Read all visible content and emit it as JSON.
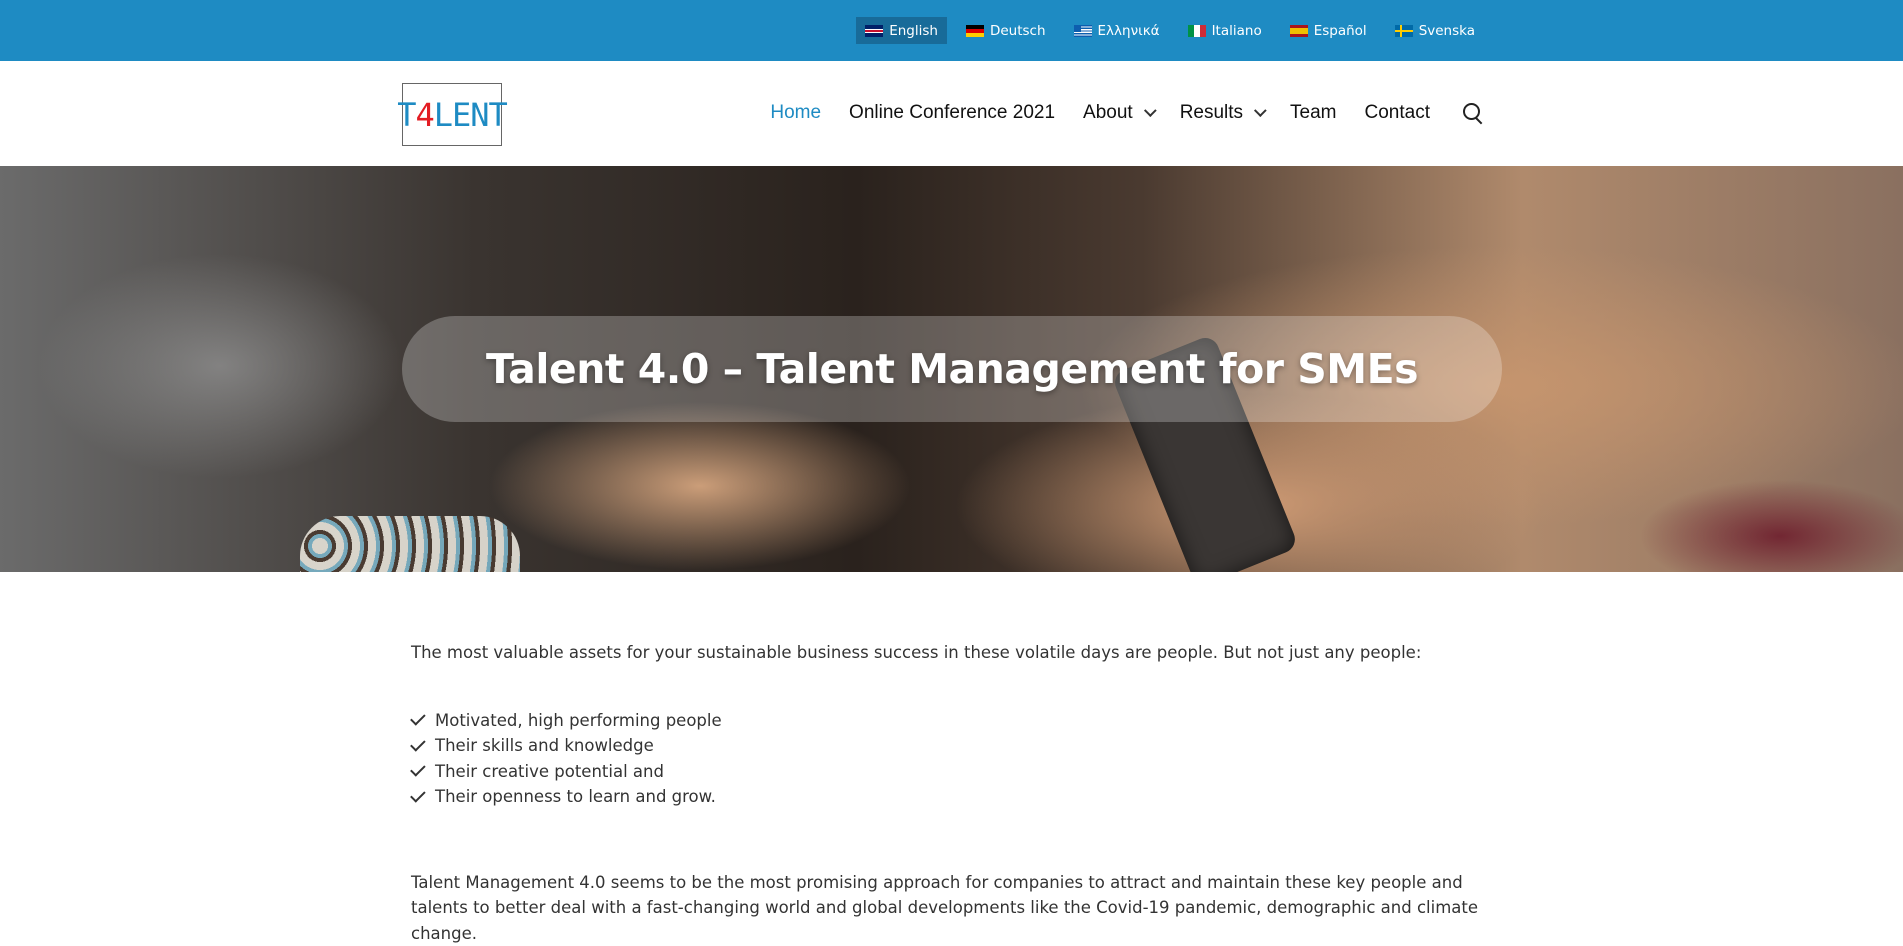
{
  "languages": [
    {
      "label": "English",
      "flag": "uk-flag-icon",
      "active": true
    },
    {
      "label": "Deutsch",
      "flag": "germany-flag-icon"
    },
    {
      "label": "Ελληνικά",
      "flag": "greece-flag-icon"
    },
    {
      "label": "Italiano",
      "flag": "italy-flag-icon"
    },
    {
      "label": "Español",
      "flag": "spain-flag-icon"
    },
    {
      "label": "Svenska",
      "flag": "sweden-flag-icon"
    }
  ],
  "logo": {
    "t": "T",
    "four": "4",
    "rest": "LENT"
  },
  "nav": {
    "home": "Home",
    "conference": "Online Conference 2021",
    "about": "About",
    "results": "Results",
    "team": "Team",
    "contact": "Contact"
  },
  "colors": {
    "top_bar": "#1e8bc3",
    "accent": "#1e8bc3",
    "logo_red": "#e31c23"
  },
  "hero": {
    "title": "Talent 4.0 – Talent Management for SMEs"
  },
  "content": {
    "intro": "The most valuable assets for your sustainable business success in these volatile days are people. But not just any people:",
    "bullets": [
      "Motivated, high performing people",
      "Their skills and knowledge",
      "Their creative potential and",
      "Their openness to learn and grow."
    ],
    "paragraph": "Talent Management 4.0 seems to be the most promising approach for companies to attract and maintain these key people and talents to better deal with a fast-changing world and global developments like the Covid-19 pandemic, demographic and climate change."
  }
}
